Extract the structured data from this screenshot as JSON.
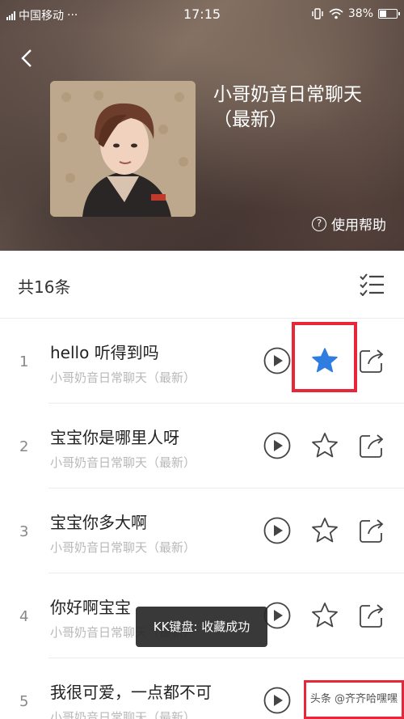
{
  "status_bar": {
    "carrier": "中国移动",
    "dots": "···",
    "time": "17:15",
    "battery": "38%"
  },
  "header": {
    "album_title": "小哥奶音日常聊天（最新）",
    "help_label": "使用帮助",
    "help_icon": "?"
  },
  "list_header": {
    "count": "共16条"
  },
  "tracks": [
    {
      "num": "1",
      "title": "hello 听得到吗",
      "subtitle": "小哥奶音日常聊天（最新）",
      "favorited": true
    },
    {
      "num": "2",
      "title": "宝宝你是哪里人呀",
      "subtitle": "小哥奶音日常聊天（最新）",
      "favorited": false
    },
    {
      "num": "3",
      "title": "宝宝你多大啊",
      "subtitle": "小哥奶音日常聊天（最新）",
      "favorited": false
    },
    {
      "num": "4",
      "title": "你好啊宝宝",
      "subtitle": "小哥奶音日常聊天（最新）",
      "favorited": false
    },
    {
      "num": "5",
      "title": "我很可爱，一点都不可",
      "subtitle": "小哥奶音日常聊天（最新）",
      "favorited": false
    }
  ],
  "toast": {
    "message": "KK键盘: 收藏成功"
  },
  "watermark": {
    "text": "头条 @齐齐哈嘿嘿"
  },
  "colors": {
    "favorite_active": "#2f7de1",
    "highlight": "#e8263a"
  }
}
